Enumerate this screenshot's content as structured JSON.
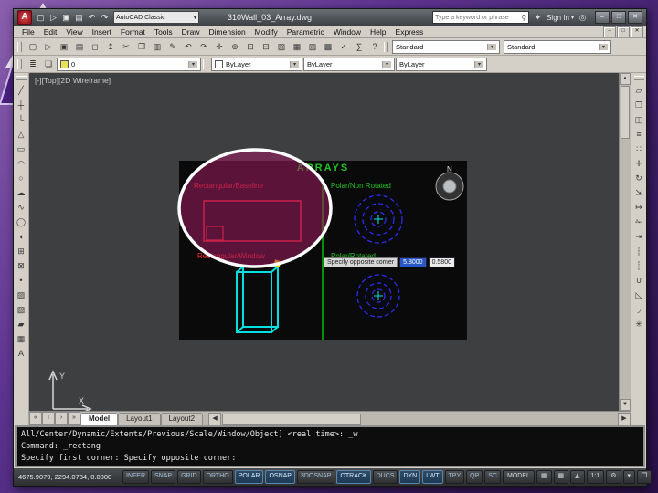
{
  "desktop": {
    "background_top": "#8a5fae",
    "background_bottom": "#2a1148",
    "logo_name": "triangle-a-logo"
  },
  "titlebar": {
    "app_button": "A",
    "quick_access": [
      {
        "name": "new-icon",
        "glyph": "▢"
      },
      {
        "name": "open-icon",
        "glyph": "▷"
      },
      {
        "name": "save-icon",
        "glyph": "▣"
      },
      {
        "name": "plot-icon",
        "glyph": "▤"
      },
      {
        "name": "undo-icon",
        "glyph": "↶"
      },
      {
        "name": "redo-icon",
        "glyph": "↷"
      }
    ],
    "workspace": "AutoCAD Classic",
    "title": "310Wall_03_Array.dwg",
    "search": {
      "placeholder": "Type a keyword or phrase",
      "icon": "⚲"
    },
    "a360_icon": "✦",
    "sign_in": "Sign In",
    "exchange_icon": "◎",
    "window_buttons": [
      {
        "name": "minimize-button",
        "glyph": "–"
      },
      {
        "name": "maximize-button",
        "glyph": "□"
      },
      {
        "name": "close-button",
        "glyph": "✕"
      }
    ]
  },
  "menu_bar": {
    "items": [
      "File",
      "Edit",
      "View",
      "Insert",
      "Format",
      "Tools",
      "Draw",
      "Dimension",
      "Modify",
      "Parametric",
      "Window",
      "Help",
      "Express"
    ],
    "doc_buttons": [
      {
        "name": "doc-minimize-button",
        "glyph": "–"
      },
      {
        "name": "doc-restore-button",
        "glyph": "□"
      },
      {
        "name": "doc-close-button",
        "glyph": "✕"
      }
    ]
  },
  "toolbar_standard": {
    "icons": [
      {
        "name": "qnew-icon",
        "glyph": "▢"
      },
      {
        "name": "open-icon",
        "glyph": "▷"
      },
      {
        "name": "save-icon",
        "glyph": "▣"
      },
      {
        "name": "plot-icon",
        "glyph": "▤"
      },
      {
        "name": "plot-preview-icon",
        "glyph": "◻"
      },
      {
        "name": "publish-icon",
        "glyph": "↥"
      },
      {
        "name": "cut-icon",
        "glyph": "✂"
      },
      {
        "name": "copy-clip-icon",
        "glyph": "❐"
      },
      {
        "name": "paste-icon",
        "glyph": "▥"
      },
      {
        "name": "match-properties-icon",
        "glyph": "✎"
      },
      {
        "name": "undo-icon",
        "glyph": "↶"
      },
      {
        "name": "redo-icon",
        "glyph": "↷"
      },
      {
        "name": "pan-icon",
        "glyph": "✛"
      },
      {
        "name": "zoom-realtime-icon",
        "glyph": "⊕"
      },
      {
        "name": "zoom-window-icon",
        "glyph": "⊡"
      },
      {
        "name": "zoom-previous-icon",
        "glyph": "⊟"
      },
      {
        "name": "properties-icon",
        "glyph": "▧"
      },
      {
        "name": "designcenter-icon",
        "glyph": "▦"
      },
      {
        "name": "tool-palettes-icon",
        "glyph": "▨"
      },
      {
        "name": "sheet-set-manager-icon",
        "glyph": "▩"
      },
      {
        "name": "markup-icon",
        "glyph": "✓"
      },
      {
        "name": "quickcalc-icon",
        "glyph": "∑"
      },
      {
        "name": "help-icon",
        "glyph": "?"
      }
    ],
    "combos": [
      {
        "name": "text-style-combo",
        "value": "Standard"
      },
      {
        "name": "dim-style-combo",
        "value": "Standard"
      }
    ]
  },
  "toolbar_layers": {
    "icons": [
      {
        "name": "layer-properties-icon",
        "glyph": "≣"
      },
      {
        "name": "layer-states-icon",
        "glyph": "❏"
      }
    ],
    "layer_combo": {
      "value": "0",
      "chip_color": "#e8e05a"
    },
    "color_combo": {
      "value": "ByLayer",
      "chip_color": "#ffffff"
    },
    "linetype_combo": {
      "value": "ByLayer"
    },
    "lineweight_combo": {
      "value": "ByLayer"
    }
  },
  "draw_toolbar": [
    {
      "name": "line-icon",
      "glyph": "╱"
    },
    {
      "name": "construction-line-icon",
      "glyph": "┼"
    },
    {
      "name": "polyline-icon",
      "glyph": "└"
    },
    {
      "name": "polygon-icon",
      "glyph": "△"
    },
    {
      "name": "rectangle-icon",
      "glyph": "▭"
    },
    {
      "name": "arc-icon",
      "glyph": "◠"
    },
    {
      "name": "circle-icon",
      "glyph": "○"
    },
    {
      "name": "revcloud-icon",
      "glyph": "☁"
    },
    {
      "name": "spline-icon",
      "glyph": "∿"
    },
    {
      "name": "ellipse-icon",
      "glyph": "◯"
    },
    {
      "name": "ellipse-arc-icon",
      "glyph": "◖"
    },
    {
      "name": "insert-block-icon",
      "glyph": "⊞"
    },
    {
      "name": "make-block-icon",
      "glyph": "⊠"
    },
    {
      "name": "point-icon",
      "glyph": "•"
    },
    {
      "name": "hatch-icon",
      "glyph": "▨"
    },
    {
      "name": "gradient-icon",
      "glyph": "▧"
    },
    {
      "name": "region-icon",
      "glyph": "▰"
    },
    {
      "name": "table-icon",
      "glyph": "▦"
    },
    {
      "name": "mtext-icon",
      "glyph": "A"
    }
  ],
  "modify_toolbar": [
    {
      "name": "erase-icon",
      "glyph": "▱"
    },
    {
      "name": "copy-icon",
      "glyph": "❐"
    },
    {
      "name": "mirror-icon",
      "glyph": "◫"
    },
    {
      "name": "offset-icon",
      "glyph": "≡"
    },
    {
      "name": "array-icon",
      "glyph": "∷"
    },
    {
      "name": "move-icon",
      "glyph": "✛"
    },
    {
      "name": "rotate-icon",
      "glyph": "↻"
    },
    {
      "name": "scale-icon",
      "glyph": "⇲"
    },
    {
      "name": "stretch-icon",
      "glyph": "↦"
    },
    {
      "name": "trim-icon",
      "glyph": "✁"
    },
    {
      "name": "extend-icon",
      "glyph": "⇥"
    },
    {
      "name": "break-at-point-icon",
      "glyph": "┆"
    },
    {
      "name": "break-icon",
      "glyph": "┊"
    },
    {
      "name": "join-icon",
      "glyph": "∪"
    },
    {
      "name": "chamfer-icon",
      "glyph": "◺"
    },
    {
      "name": "fillet-icon",
      "glyph": "◞"
    },
    {
      "name": "explode-icon",
      "glyph": "✳"
    }
  ],
  "viewport_label": "[-][Top][2D Wireframe]",
  "canvas": {
    "colors": {
      "red": "#ff2b2b",
      "green": "#21c421",
      "blue": "#2e2eff",
      "cyan": "#00e0e0",
      "yellow": "#ffd400",
      "divider_green": "#00bb00"
    },
    "panel": {
      "title": "ARRAYS",
      "quadrants": [
        {
          "label": "Rectangular/Baseline",
          "color": "#ff2b2b"
        },
        {
          "label": "Polar/Non Rotated",
          "color": "#21c421"
        },
        {
          "label": "Rectangular/Window",
          "color": "#ff2b2b"
        },
        {
          "label": "Polar/Rotated",
          "color": "#21c421"
        }
      ],
      "tooltip": {
        "label": "Specify opposite corner",
        "value_primary": "5.8000",
        "value_secondary": "0.5800"
      }
    },
    "viewcube": {
      "north": "N"
    },
    "ucs": {
      "x_label": "X",
      "y_label": "Y"
    },
    "annotation": {
      "stroke": "#ffffff",
      "fill": "rgba(158,28,96,0.55)"
    }
  },
  "tabs": {
    "nav": [
      {
        "name": "first-tab-button",
        "glyph": "«"
      },
      {
        "name": "prev-tab-button",
        "glyph": "‹"
      },
      {
        "name": "next-tab-button",
        "glyph": "›"
      },
      {
        "name": "last-tab-button",
        "glyph": "»"
      }
    ],
    "items": [
      {
        "label": "Model",
        "state": "active"
      },
      {
        "label": "Layout1",
        "state": ""
      },
      {
        "label": "Layout2",
        "state": ""
      }
    ]
  },
  "command": {
    "lines": [
      "All/Center/Dynamic/Extents/Previous/Scale/Window/Object] <real time>: _w",
      "Command: _rectang",
      "Specify first corner: Specify opposite corner:"
    ]
  },
  "status": {
    "coords": "4675.9079, 2294.0734, 0.0000",
    "toggles": [
      {
        "label": "INFER",
        "state": ""
      },
      {
        "label": "SNAP",
        "state": ""
      },
      {
        "label": "GRID",
        "state": ""
      },
      {
        "label": "ORTHO",
        "state": ""
      },
      {
        "label": "POLAR",
        "state": "on"
      },
      {
        "label": "OSNAP",
        "state": "on"
      },
      {
        "label": "3DOSNAP",
        "state": ""
      },
      {
        "label": "OTRACK",
        "state": "on"
      },
      {
        "label": "DUCS",
        "state": ""
      },
      {
        "label": "DYN",
        "state": "on"
      },
      {
        "label": "LWT",
        "state": "on"
      },
      {
        "label": "TPY",
        "state": ""
      },
      {
        "label": "QP",
        "state": ""
      },
      {
        "label": "SC",
        "state": ""
      }
    ],
    "model_button": "MODEL",
    "right_icons": [
      {
        "name": "quick-view-layouts-icon",
        "glyph": "▦"
      },
      {
        "name": "quick-view-drawings-icon",
        "glyph": "▩"
      },
      {
        "name": "annotation-scale-icon",
        "glyph": "◭"
      },
      {
        "name": "annotation-scale-value",
        "glyph": "1:1"
      },
      {
        "name": "workspace-switching-icon",
        "glyph": "⚙"
      },
      {
        "name": "status-menu-icon",
        "glyph": "▾"
      },
      {
        "name": "clean-screen-icon",
        "glyph": "❒"
      }
    ]
  }
}
